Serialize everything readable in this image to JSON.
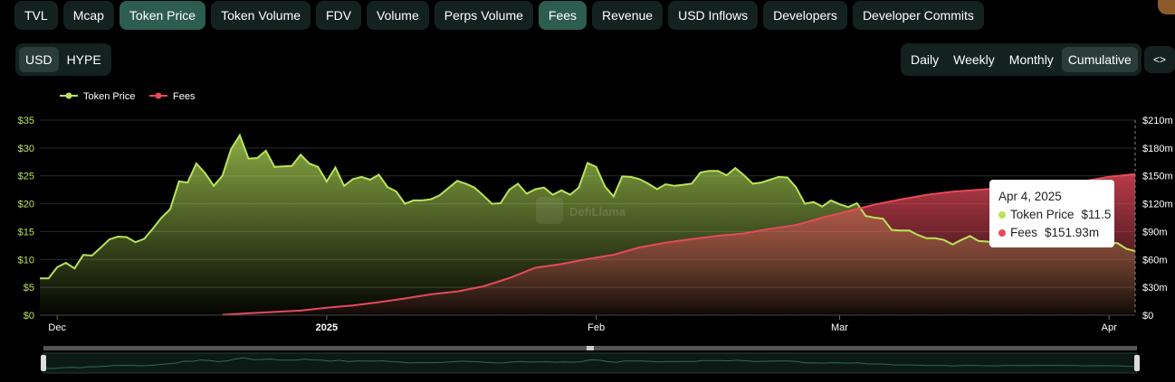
{
  "tabs": [
    {
      "label": "TVL",
      "active": false
    },
    {
      "label": "Mcap",
      "active": false
    },
    {
      "label": "Token Price",
      "active": true
    },
    {
      "label": "Token Volume",
      "active": false
    },
    {
      "label": "FDV",
      "active": false
    },
    {
      "label": "Volume",
      "active": false
    },
    {
      "label": "Perps Volume",
      "active": false
    },
    {
      "label": "Fees",
      "active": true
    },
    {
      "label": "Revenue",
      "active": false
    },
    {
      "label": "USD Inflows",
      "active": false
    },
    {
      "label": "Developers",
      "active": false
    },
    {
      "label": "Developer Commits",
      "active": false
    }
  ],
  "denomination": {
    "options": [
      "USD",
      "HYPE"
    ],
    "selected": "USD"
  },
  "grouping": {
    "options": [
      "Daily",
      "Weekly",
      "Monthly",
      "Cumulative"
    ],
    "selected": "Cumulative"
  },
  "embed_icon": "<>",
  "watermark": "DefiLlama",
  "colors": {
    "token_price": "#b8e35a",
    "fees": "#e64a5a",
    "accent_tab": "#2d5c50",
    "panel": "#13221e"
  },
  "tooltip": {
    "date": "Apr 4, 2025",
    "rows": [
      {
        "label": "Token Price",
        "value": "$11.5",
        "color": "#b8e35a"
      },
      {
        "label": "Fees",
        "value": "$151.93m",
        "color": "#e64a5a"
      }
    ]
  },
  "chart_data": {
    "type": "area",
    "legend": [
      "Token Price",
      "Fees"
    ],
    "legend_position": "top-left",
    "grid": true,
    "x_ticks": [
      "Dec",
      "2025",
      "Feb",
      "Mar",
      "Apr"
    ],
    "x_range": [
      "2024-11-29",
      "2025-04-04"
    ],
    "y_left": {
      "ticks": [
        "$0",
        "$5",
        "$10",
        "$15",
        "$20",
        "$25",
        "$30",
        "$35"
      ],
      "ylim": [
        0,
        35
      ]
    },
    "y_right": {
      "ticks": [
        "$0",
        "$30m",
        "$60m",
        "$90m",
        "$120m",
        "$150m",
        "$180m",
        "$210m"
      ],
      "ylim": [
        0,
        210
      ]
    },
    "series": [
      {
        "name": "Token Price",
        "axis": "left",
        "unit": "USD",
        "points": [
          [
            "2024-11-29",
            6.6
          ],
          [
            "2024-11-30",
            6.6
          ],
          [
            "2024-12-01",
            8.6
          ],
          [
            "2024-12-02",
            9.4
          ],
          [
            "2024-12-03",
            8.4
          ],
          [
            "2024-12-04",
            10.8
          ],
          [
            "2024-12-05",
            10.7
          ],
          [
            "2024-12-06",
            12.1
          ],
          [
            "2024-12-07",
            13.6
          ],
          [
            "2024-12-08",
            14.1
          ],
          [
            "2024-12-09",
            14.0
          ],
          [
            "2024-12-10",
            13.1
          ],
          [
            "2024-12-11",
            13.7
          ],
          [
            "2024-12-12",
            15.5
          ],
          [
            "2024-12-13",
            17.5
          ],
          [
            "2024-12-14",
            19.0
          ],
          [
            "2024-12-15",
            24.0
          ],
          [
            "2024-12-16",
            23.8
          ],
          [
            "2024-12-17",
            27.2
          ],
          [
            "2024-12-18",
            25.5
          ],
          [
            "2024-12-19",
            23.2
          ],
          [
            "2024-12-20",
            25.0
          ],
          [
            "2024-12-21",
            29.8
          ],
          [
            "2024-12-22",
            32.3
          ],
          [
            "2024-12-23",
            28.1
          ],
          [
            "2024-12-24",
            28.2
          ],
          [
            "2024-12-25",
            29.5
          ],
          [
            "2024-12-26",
            26.6
          ],
          [
            "2024-12-27",
            26.7
          ],
          [
            "2024-12-28",
            26.8
          ],
          [
            "2024-12-29",
            28.8
          ],
          [
            "2024-12-30",
            27.2
          ],
          [
            "2024-12-31",
            26.6
          ],
          [
            "2025-01-01",
            24.0
          ],
          [
            "2025-01-02",
            26.5
          ],
          [
            "2025-01-03",
            23.2
          ],
          [
            "2025-01-04",
            24.4
          ],
          [
            "2025-01-05",
            24.8
          ],
          [
            "2025-01-06",
            24.3
          ],
          [
            "2025-01-07",
            25.2
          ],
          [
            "2025-01-08",
            23.0
          ],
          [
            "2025-01-09",
            22.2
          ],
          [
            "2025-01-10",
            20.0
          ],
          [
            "2025-01-11",
            20.6
          ],
          [
            "2025-01-12",
            20.6
          ],
          [
            "2025-01-13",
            20.8
          ],
          [
            "2025-01-14",
            21.5
          ],
          [
            "2025-01-15",
            22.8
          ],
          [
            "2025-01-16",
            24.1
          ],
          [
            "2025-01-17",
            23.6
          ],
          [
            "2025-01-18",
            22.9
          ],
          [
            "2025-01-19",
            21.5
          ],
          [
            "2025-01-20",
            20.0
          ],
          [
            "2025-01-21",
            20.1
          ],
          [
            "2025-01-22",
            22.5
          ],
          [
            "2025-01-23",
            23.6
          ],
          [
            "2025-01-24",
            21.8
          ],
          [
            "2025-01-25",
            22.6
          ],
          [
            "2025-01-26",
            22.9
          ],
          [
            "2025-01-27",
            21.6
          ],
          [
            "2025-01-28",
            22.4
          ],
          [
            "2025-01-29",
            21.6
          ],
          [
            "2025-01-30",
            22.9
          ],
          [
            "2025-01-31",
            27.3
          ],
          [
            "2025-02-01",
            26.6
          ],
          [
            "2025-02-02",
            23.1
          ],
          [
            "2025-02-03",
            21.3
          ],
          [
            "2025-02-04",
            24.9
          ],
          [
            "2025-02-05",
            24.8
          ],
          [
            "2025-02-06",
            24.4
          ],
          [
            "2025-02-07",
            23.6
          ],
          [
            "2025-02-08",
            22.6
          ],
          [
            "2025-02-09",
            23.5
          ],
          [
            "2025-02-10",
            23.2
          ],
          [
            "2025-02-11",
            23.4
          ],
          [
            "2025-02-12",
            23.6
          ],
          [
            "2025-02-13",
            25.6
          ],
          [
            "2025-02-14",
            25.9
          ],
          [
            "2025-02-15",
            25.9
          ],
          [
            "2025-02-16",
            25.1
          ],
          [
            "2025-02-17",
            26.4
          ],
          [
            "2025-02-18",
            25.1
          ],
          [
            "2025-02-19",
            23.6
          ],
          [
            "2025-02-20",
            23.8
          ],
          [
            "2025-02-21",
            24.3
          ],
          [
            "2025-02-22",
            24.8
          ],
          [
            "2025-02-23",
            24.7
          ],
          [
            "2025-02-24",
            22.9
          ],
          [
            "2025-02-25",
            20.0
          ],
          [
            "2025-02-26",
            20.3
          ],
          [
            "2025-02-27",
            19.5
          ],
          [
            "2025-02-28",
            20.6
          ],
          [
            "2025-03-01",
            19.9
          ],
          [
            "2025-03-02",
            19.4
          ],
          [
            "2025-03-03",
            20.1
          ],
          [
            "2025-03-04",
            17.8
          ],
          [
            "2025-03-05",
            17.5
          ],
          [
            "2025-03-06",
            17.3
          ],
          [
            "2025-03-07",
            15.3
          ],
          [
            "2025-03-08",
            15.2
          ],
          [
            "2025-03-09",
            15.2
          ],
          [
            "2025-03-10",
            14.4
          ],
          [
            "2025-03-11",
            13.8
          ],
          [
            "2025-03-12",
            13.8
          ],
          [
            "2025-03-13",
            13.5
          ],
          [
            "2025-03-14",
            12.7
          ],
          [
            "2025-03-15",
            13.5
          ],
          [
            "2025-03-16",
            14.2
          ],
          [
            "2025-03-17",
            13.3
          ],
          [
            "2025-03-18",
            13.2
          ],
          [
            "2025-03-19",
            13.0
          ],
          [
            "2025-03-20",
            13.6
          ],
          [
            "2025-03-21",
            13.8
          ],
          [
            "2025-03-22",
            13.4
          ],
          [
            "2025-03-23",
            13.5
          ],
          [
            "2025-03-24",
            14.1
          ],
          [
            "2025-03-25",
            13.9
          ],
          [
            "2025-03-26",
            14.0
          ],
          [
            "2025-03-27",
            13.5
          ],
          [
            "2025-03-28",
            13.6
          ],
          [
            "2025-03-29",
            13.0
          ],
          [
            "2025-03-30",
            13.1
          ],
          [
            "2025-03-31",
            13.3
          ],
          [
            "2025-04-01",
            13.1
          ],
          [
            "2025-04-02",
            12.9
          ],
          [
            "2025-04-03",
            11.9
          ],
          [
            "2025-04-04",
            11.5
          ]
        ]
      },
      {
        "name": "Fees",
        "axis": "right",
        "unit": "USD millions",
        "points": [
          [
            "2024-12-20",
            0.5
          ],
          [
            "2024-12-23",
            2.0
          ],
          [
            "2024-12-26",
            3.5
          ],
          [
            "2024-12-29",
            5.0
          ],
          [
            "2025-01-01",
            8.0
          ],
          [
            "2025-01-04",
            10.5
          ],
          [
            "2025-01-07",
            14.0
          ],
          [
            "2025-01-10",
            18.0
          ],
          [
            "2025-01-13",
            22.5
          ],
          [
            "2025-01-16",
            25.5
          ],
          [
            "2025-01-19",
            31.0
          ],
          [
            "2025-01-22",
            40.0
          ],
          [
            "2025-01-25",
            51.0
          ],
          [
            "2025-01-28",
            55.0
          ],
          [
            "2025-01-31",
            60.5
          ],
          [
            "2025-02-03",
            65.0
          ],
          [
            "2025-02-06",
            73.0
          ],
          [
            "2025-02-09",
            78.0
          ],
          [
            "2025-02-12",
            82.0
          ],
          [
            "2025-02-15",
            85.5
          ],
          [
            "2025-02-18",
            88.0
          ],
          [
            "2025-02-21",
            93.0
          ],
          [
            "2025-02-24",
            97.0
          ],
          [
            "2025-02-27",
            105.0
          ],
          [
            "2025-03-02",
            112.0
          ],
          [
            "2025-03-05",
            119.0
          ],
          [
            "2025-03-08",
            124.5
          ],
          [
            "2025-03-11",
            129.5
          ],
          [
            "2025-03-14",
            133.0
          ],
          [
            "2025-03-17",
            135.0
          ],
          [
            "2025-03-20",
            137.0
          ],
          [
            "2025-03-23",
            139.0
          ],
          [
            "2025-03-26",
            141.0
          ],
          [
            "2025-03-29",
            144.0
          ],
          [
            "2025-04-01",
            149.0
          ],
          [
            "2025-04-04",
            151.93
          ]
        ]
      }
    ]
  }
}
